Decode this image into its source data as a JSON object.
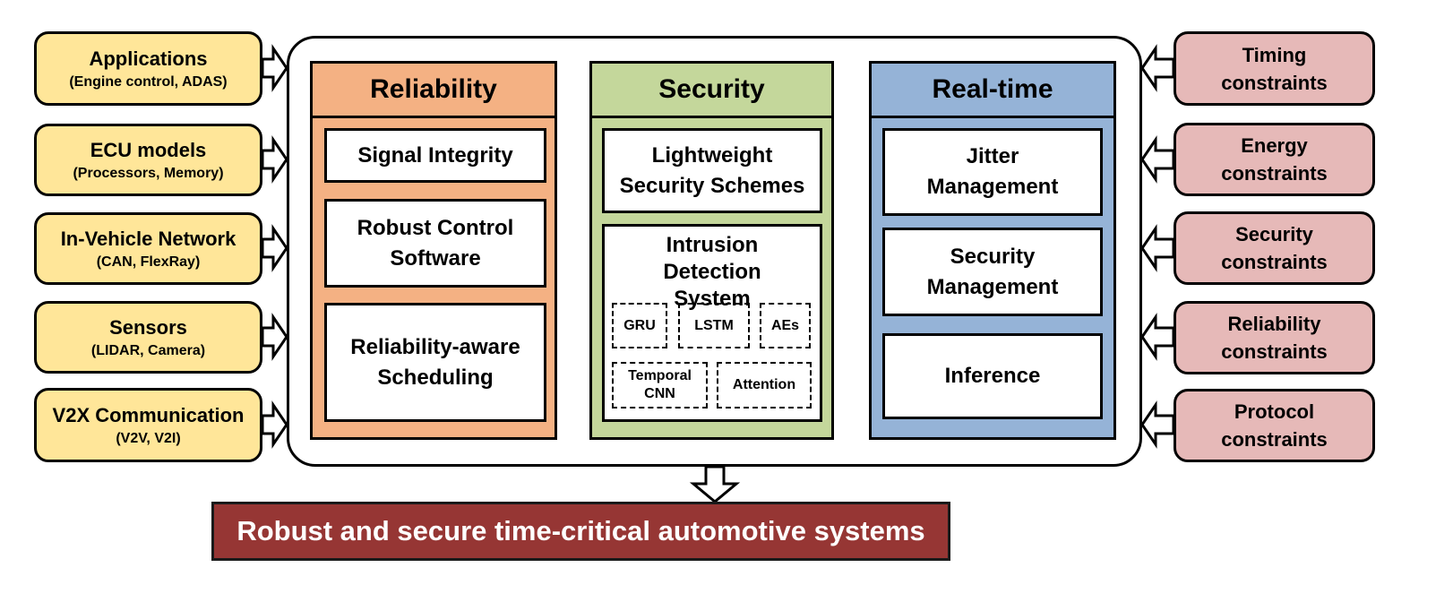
{
  "inputs": [
    {
      "title": "Applications",
      "sub": "(Engine control, ADAS)"
    },
    {
      "title": "ECU models",
      "sub": "(Processors, Memory)"
    },
    {
      "title": "In-Vehicle Network",
      "sub": "(CAN, FlexRay)"
    },
    {
      "title": "Sensors",
      "sub": "(LIDAR, Camera)"
    },
    {
      "title": "V2X Communication",
      "sub": "(V2V, V2I)"
    }
  ],
  "constraints": [
    {
      "l1": "Timing",
      "l2": "constraints"
    },
    {
      "l1": "Energy",
      "l2": "constraints"
    },
    {
      "l1": "Security",
      "l2": "constraints"
    },
    {
      "l1": "Reliability",
      "l2": "constraints"
    },
    {
      "l1": "Protocol",
      "l2": "constraints"
    }
  ],
  "reliability": {
    "title": "Reliability",
    "items": [
      "Signal Integrity",
      "Robust Control Software",
      "Reliability-aware Scheduling"
    ],
    "color": "#F4B183"
  },
  "security": {
    "title": "Security",
    "lightweight": "Lightweight Security Schemes",
    "ids": "Intrusion Detection System",
    "models": [
      "GRU",
      "LSTM",
      "AEs",
      "Temporal CNN",
      "Attention"
    ],
    "color": "#C4D79B"
  },
  "realtime": {
    "title": "Real-time",
    "items": [
      "Jitter Management",
      "Security Management",
      "Inference"
    ],
    "color": "#95B3D7"
  },
  "output": "Robust and secure time-critical automotive systems",
  "colors": {
    "input": "#FFE699",
    "constraint": "#E6B9B8",
    "output": "#963634"
  }
}
